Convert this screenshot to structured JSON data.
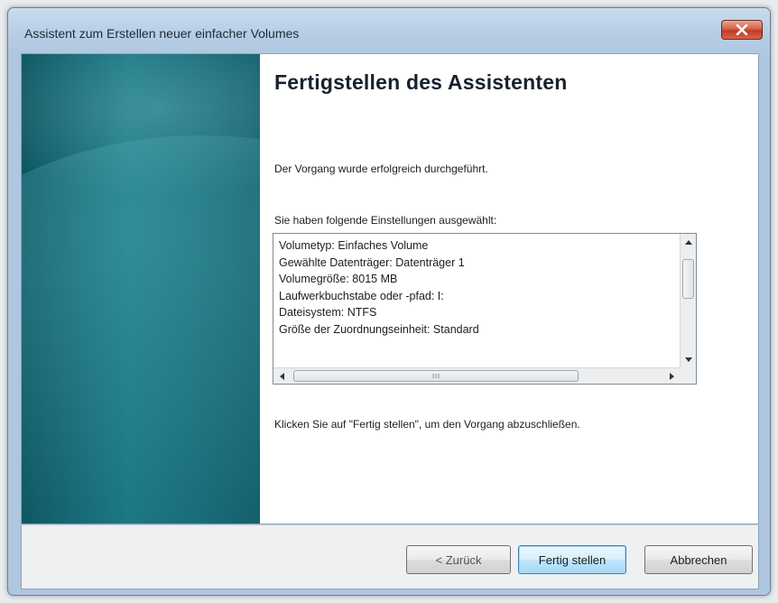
{
  "window": {
    "title": "Assistent zum Erstellen neuer einfacher Volumes"
  },
  "main": {
    "heading": "Fertigstellen des Assistenten",
    "status_text": "Der Vorgang wurde erfolgreich durchgeführt.",
    "settings_label": "Sie haben folgende Einstellungen ausgewählt:",
    "settings_items": [
      "Volumetyp: Einfaches Volume",
      "Gewählte Datenträger: Datenträger 1",
      "Volumegröße: 8015 MB",
      "Laufwerkbuchstabe oder -pfad: I:",
      "Dateisystem: NTFS",
      "Größe der Zuordnungseinheit: Standard"
    ],
    "finish_hint": "Klicken Sie auf \"Fertig stellen\", um den Vorgang abzuschließen."
  },
  "buttons": {
    "back": "< Zurück",
    "finish": "Fertig stellen",
    "cancel": "Abbrechen"
  },
  "colors": {
    "banner": "#1a7682",
    "title_bar": "#b7cde4",
    "close_button": "#c13a24",
    "default_button_border": "#3c7fb1"
  }
}
